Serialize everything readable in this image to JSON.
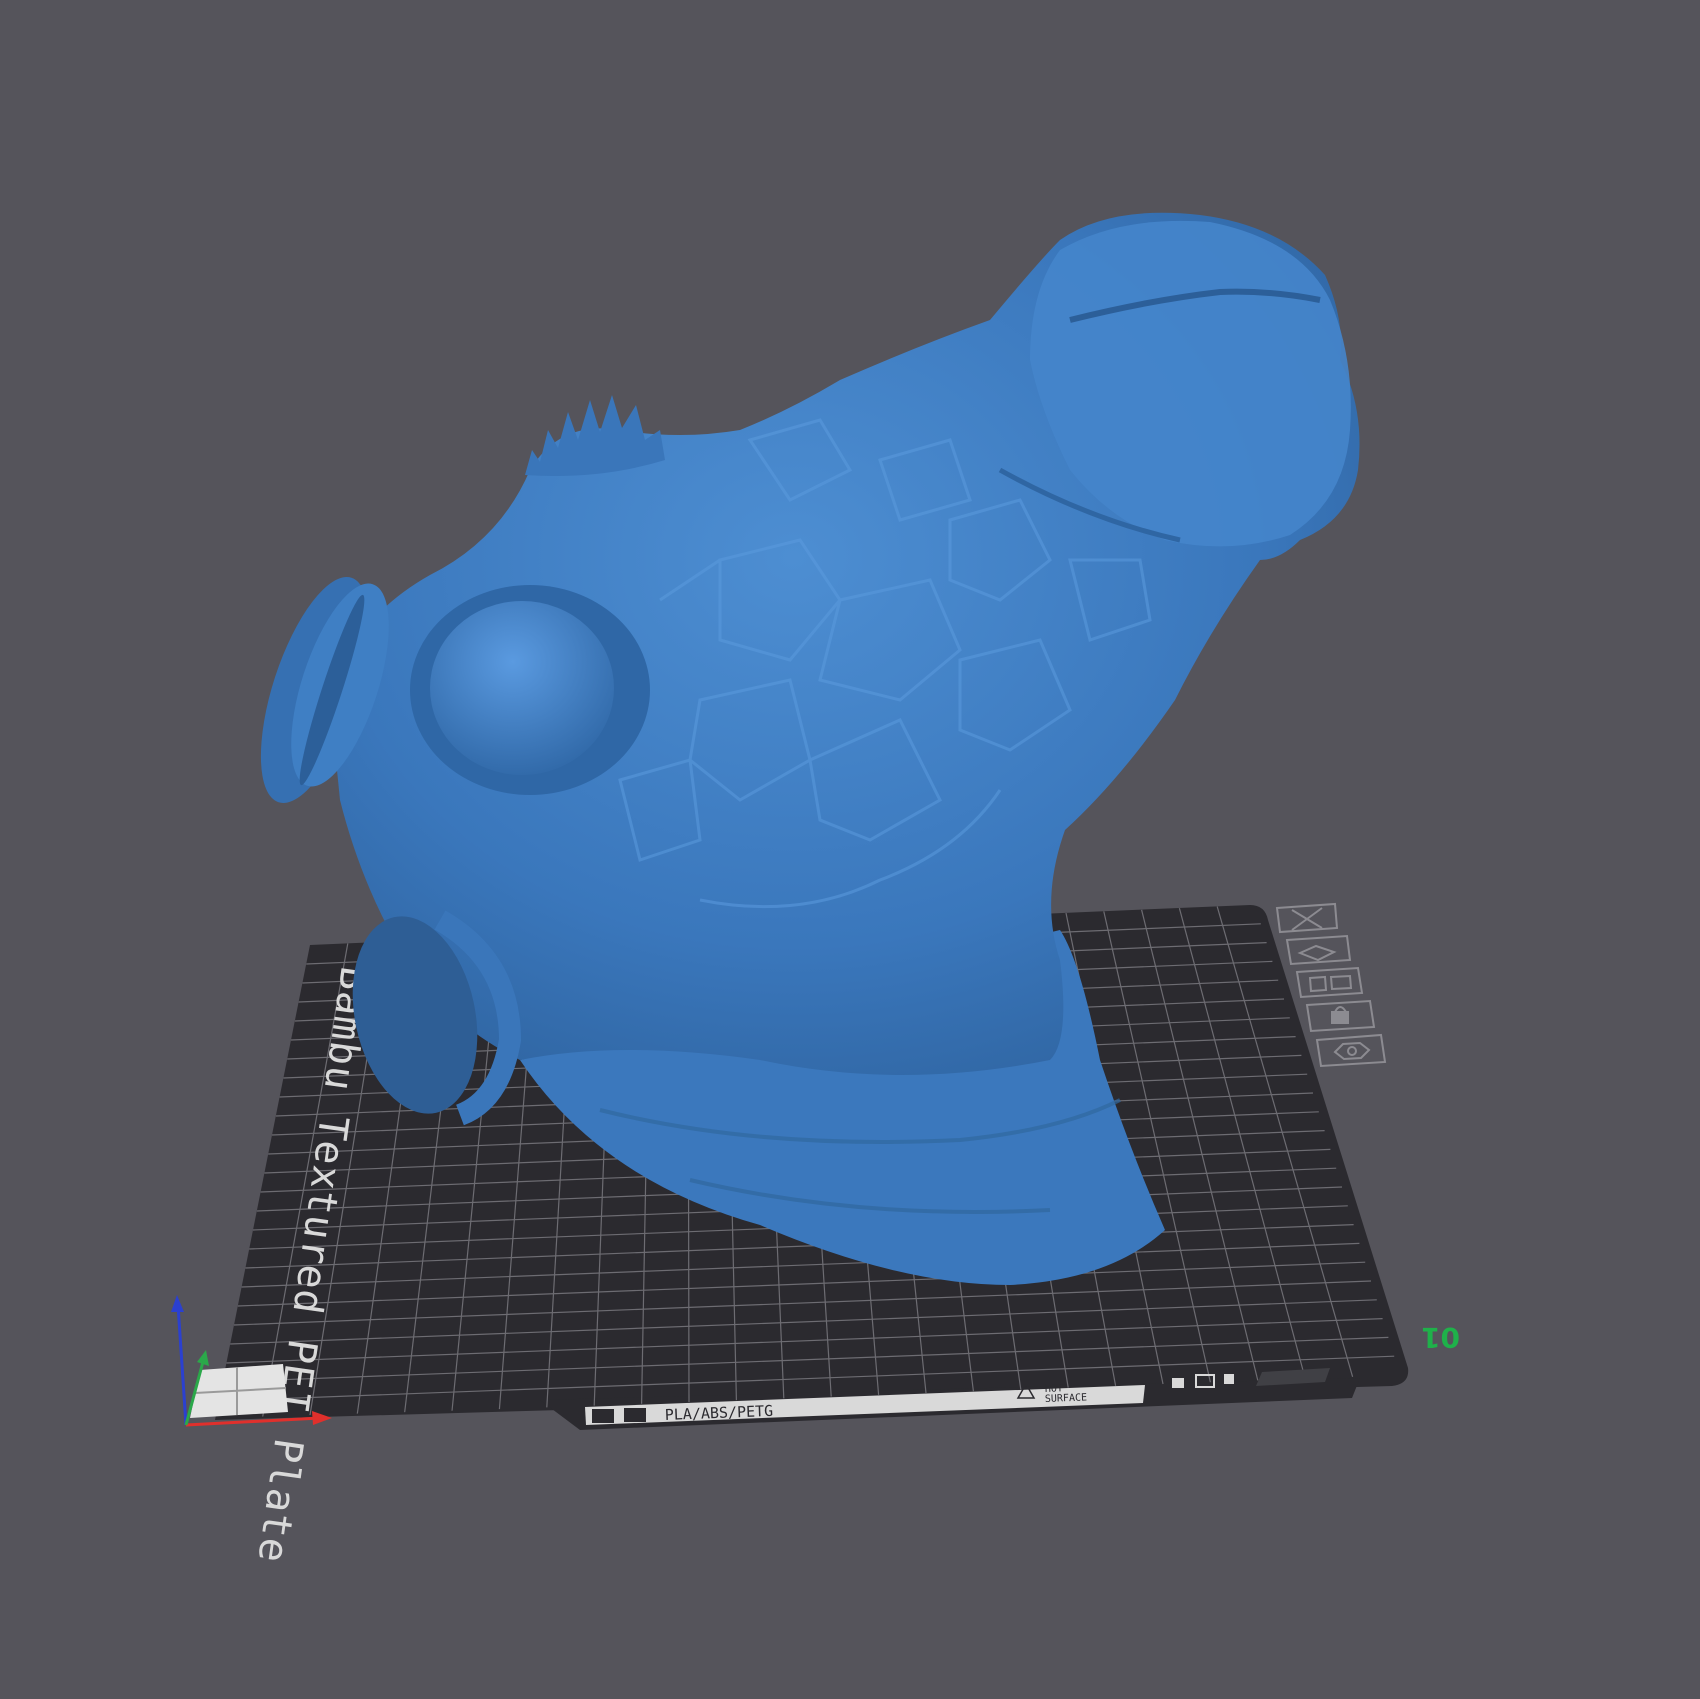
{
  "viewport": {
    "background_color": "#55545b",
    "model_color": "#3f7fc4"
  },
  "build_plate": {
    "plate_name": "Bambu Textured PEI Plate",
    "material_label": "PLA/ABS/PETG",
    "warning_label_line1": "HOT",
    "warning_label_line2": "SURFACE",
    "plate_number": "01",
    "plate_color": "#2b2a2f",
    "grid_color": "#6d6c72",
    "plate_number_color": "#1fb14a"
  },
  "plate_toolbar": {
    "icons": [
      {
        "name": "close-plate-icon",
        "glyph": "✕"
      },
      {
        "name": "auto-orient-icon",
        "glyph": "⟲"
      },
      {
        "name": "arrange-icon",
        "glyph": "▭"
      },
      {
        "name": "lock-icon",
        "glyph": "🔒"
      },
      {
        "name": "plate-settings-icon",
        "glyph": "⬡"
      }
    ]
  },
  "axes": {
    "x_color": "#e0302c",
    "y_color": "#2ba84a",
    "z_color": "#2b40d0"
  }
}
